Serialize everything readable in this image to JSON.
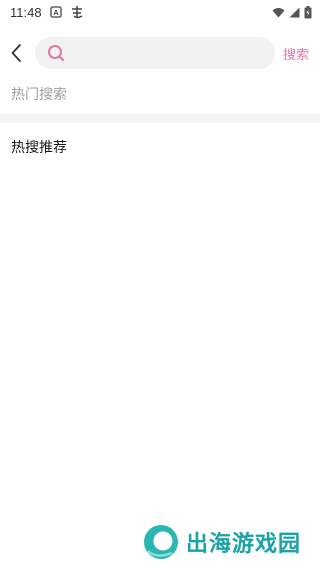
{
  "status_bar": {
    "time": "11:48",
    "icons": [
      "a-box-icon",
      "kanji-icon",
      "wifi-icon",
      "signal-icon",
      "battery-icon"
    ]
  },
  "header": {
    "back_icon": "chevron-left-icon",
    "search": {
      "placeholder": "",
      "value": "",
      "icon": "search-icon"
    },
    "search_button_label": "搜索"
  },
  "sections": {
    "hot_search_title": "热门搜索",
    "recommend_title": "热搜推荐"
  },
  "watermark": {
    "text": "出海游戏园"
  },
  "colors": {
    "accent": "#e07aa6",
    "muted_text": "#9e9e9e",
    "divider": "#f4f4f4",
    "search_bg": "#f2f2f2",
    "watermark": "#19a3a6"
  }
}
